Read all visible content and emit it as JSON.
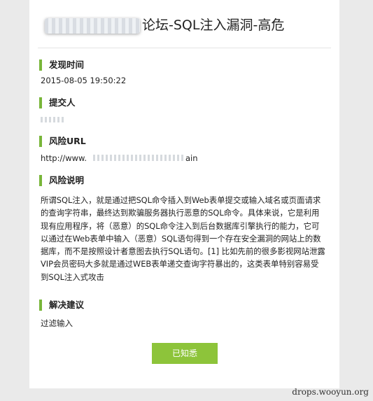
{
  "report": {
    "title": "论坛-SQL注入漏洞-高危",
    "sections": {
      "found_time": {
        "label": "发现时间",
        "value": "2015-08-05 19:50:22"
      },
      "submitter": {
        "label": "提交人",
        "value": ""
      },
      "risk_url": {
        "label": "风险URL",
        "value_prefix": "http://www.",
        "value_suffix": "ain"
      },
      "risk_desc": {
        "label": "风险说明",
        "text": "所谓SQL注入，就是通过把SQL命令插入到Web表单提交或输入域名或页面请求\n的查询字符串，最终达到欺骗服务器执行恶意的SQL命令。具体来说，它是利用\n现有应用程序，将（恶意）的SQL命令注入到后台数据库引擎执行的能力，它可\n以通过在Web表单中输入（恶意）SQL语句得到一个存在安全漏洞的网站上的数\n据库，而不是按照设计者意图去执行SQL语句。[1] 比如先前的很多影视网站泄露\nVIP会员密码大多就是通过WEB表单递交查询字符暴出的，这类表单特别容易受\n到SQL注入式攻击"
      },
      "solution": {
        "label": "解决建议",
        "value": "过滤输入"
      }
    },
    "ack_button": "已知悉"
  },
  "watermark": "drops.wooyun.org",
  "colors": {
    "accent": "#79b63a",
    "button": "#8dc43a",
    "background": "#eaeaea",
    "card": "#ffffff"
  }
}
